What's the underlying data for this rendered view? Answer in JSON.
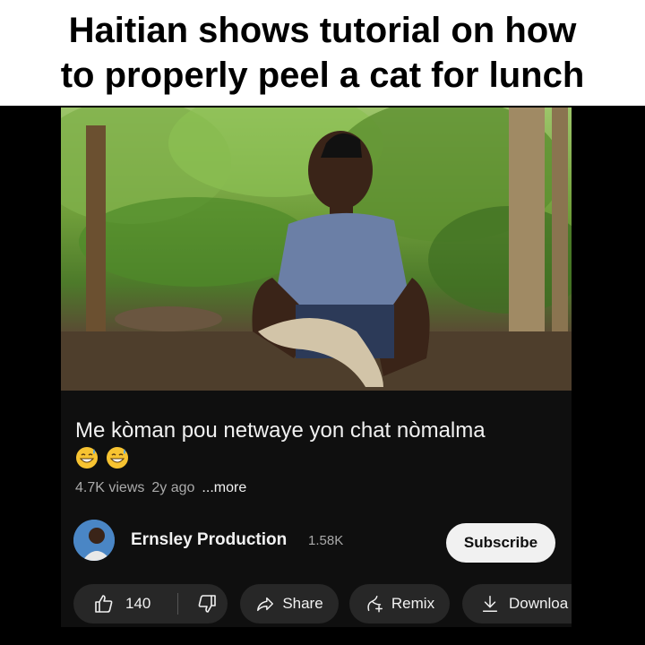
{
  "caption": {
    "line1": "Haitian shows tutorial on how",
    "line2": "to properly peel a cat for lunch"
  },
  "video": {
    "title": "Me kòman pou netwaye yon chat nòmalma",
    "emojis": [
      "grinning-sweat-emoji",
      "grinning-sweat-emoji"
    ],
    "views": "4.7K views",
    "age": "2y ago",
    "more_label": "...more"
  },
  "channel": {
    "name": "Ernsley Production",
    "subscribers": "1.58K",
    "subscribe_label": "Subscribe"
  },
  "actions": {
    "like_count": "140",
    "share_label": "Share",
    "remix_label": "Remix",
    "download_label": "Downloa"
  },
  "colors": {
    "panel_bg": "#0f0f0f",
    "pill_bg": "#272727",
    "text_primary": "#f1f1f1",
    "text_secondary": "#aaaaaa"
  }
}
